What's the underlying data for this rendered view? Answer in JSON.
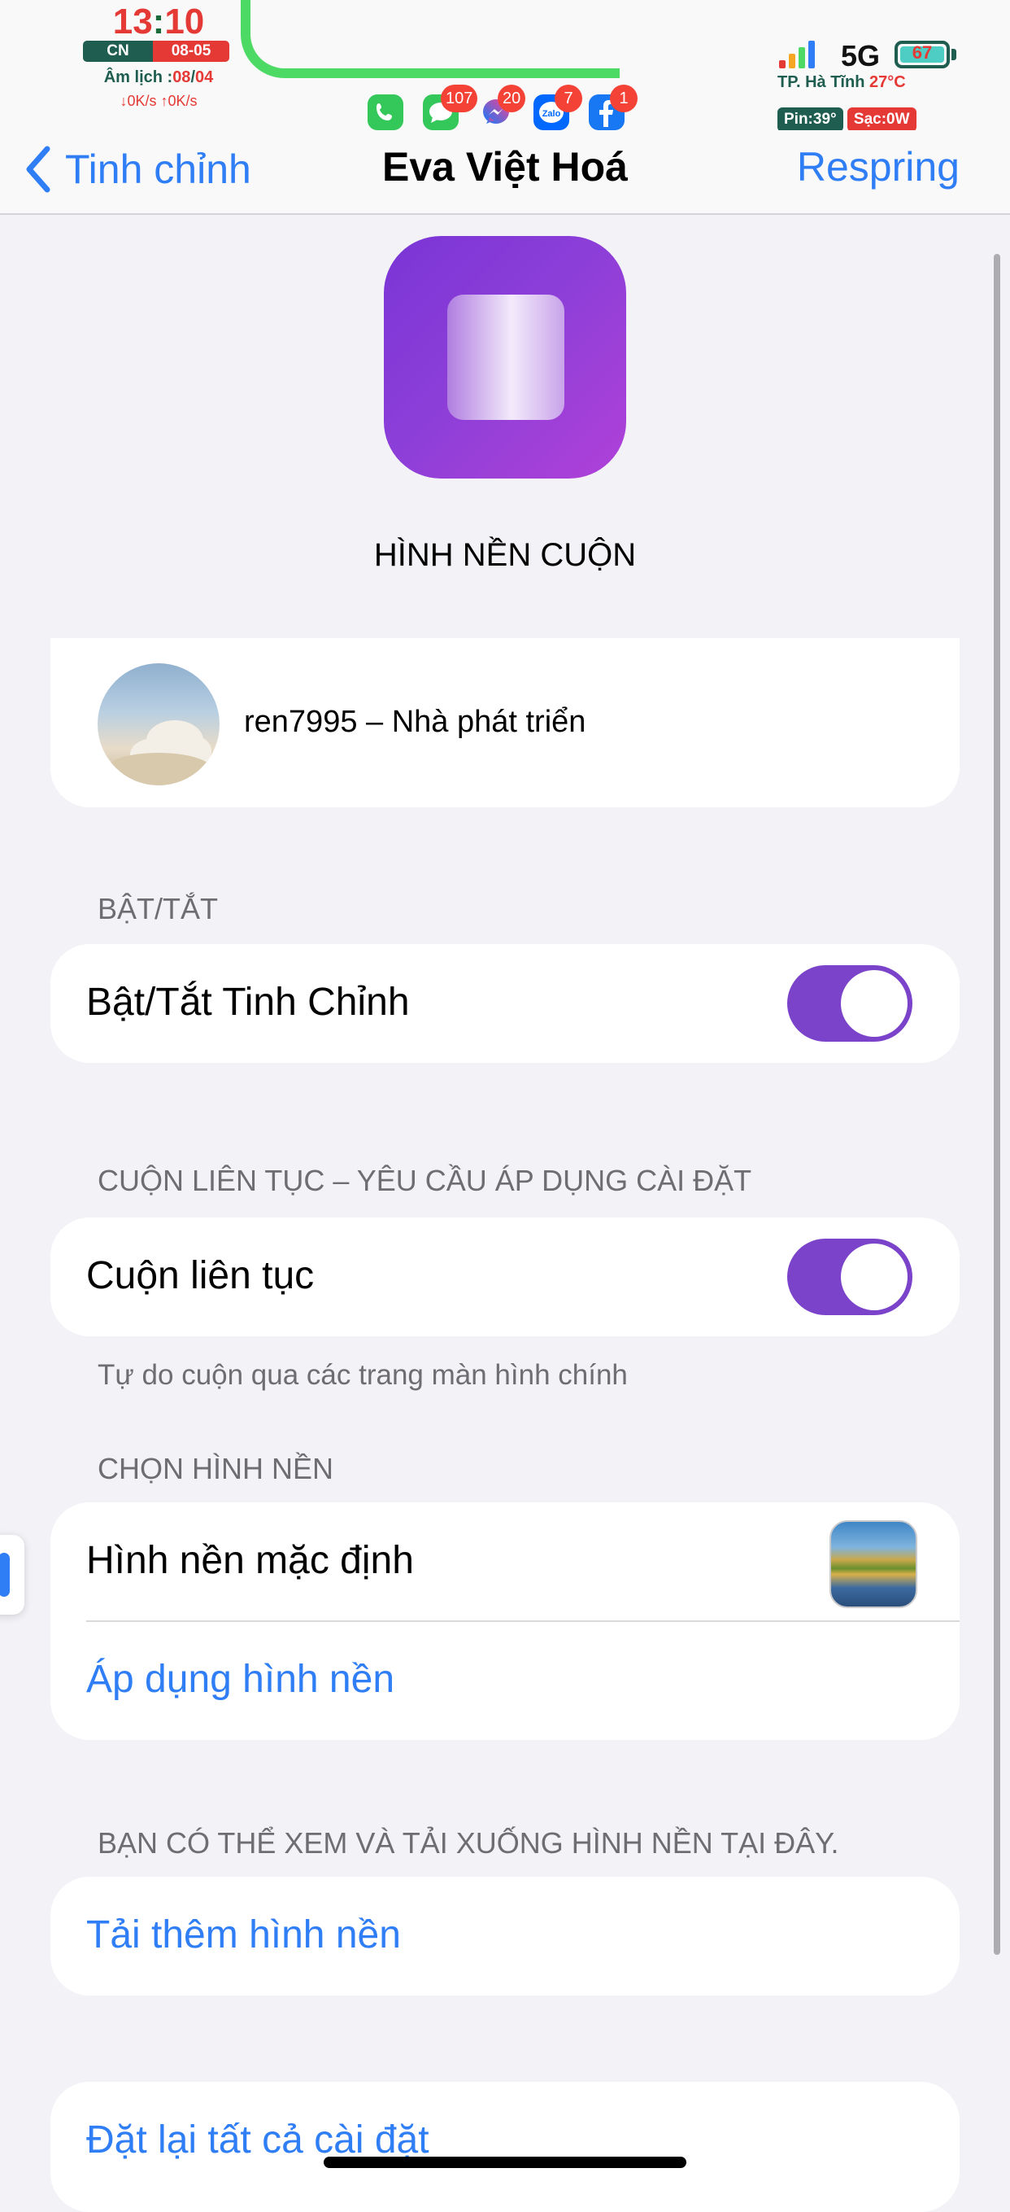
{
  "status_bar": {
    "time_hour": "13",
    "time_sep": ":",
    "time_min": "10",
    "weekday": "CN",
    "date": "08-05",
    "lunar_prefix": "Âm lịch :",
    "lunar_day": "08",
    "lunar_sep": "/",
    "lunar_month": "04",
    "net_speed": "↓0K/s ↑0K/s",
    "notifications": [
      {
        "app": "phone-icon",
        "color": "#34c759",
        "badge": ""
      },
      {
        "app": "messages-icon",
        "color": "#34c759",
        "badge": "107"
      },
      {
        "app": "messenger-icon",
        "color": "#7a5cff",
        "badge": "20"
      },
      {
        "app": "zalo-icon",
        "color": "#0068ff",
        "badge": "7"
      },
      {
        "app": "facebook-icon",
        "color": "#1877f2",
        "badge": "1"
      }
    ],
    "network": "5G",
    "battery": "67",
    "weather_city": "TP. Hà Tĩnh",
    "weather_temp": "27°C",
    "pin_temp": "Pin:39°",
    "charge": "Sạc:0W"
  },
  "nav": {
    "back_label": "Tinh chỉnh",
    "title": "Eva Việt Hoá",
    "right_action": "Respring"
  },
  "header": {
    "tweak_name": "HÌNH NỀN CUỘN"
  },
  "developer": {
    "label": "ren7995 – Nhà phát triển"
  },
  "section_enable": {
    "header": "BẬT/TẮT",
    "row_label": "Bật/Tắt Tinh Chỉnh",
    "enabled": true
  },
  "section_scroll": {
    "header": "CUỘN LIÊN TỤC – YÊU CẦU ÁP DỤNG CÀI ĐẶT",
    "row_label": "Cuộn liên tục",
    "enabled": true,
    "footer": "Tự do cuộn qua các trang màn hình chính"
  },
  "section_wallpaper": {
    "header": "CHỌN HÌNH NỀN",
    "row_label": "Hình nền mặc định",
    "apply_label": "Áp dụng hình nền"
  },
  "section_download": {
    "header": "BẠN CÓ THỂ XEM VÀ TẢI XUỐNG HÌNH NỀN TẠI ĐÂY.",
    "link_label": "Tải thêm hình nền"
  },
  "section_reset": {
    "link_label": "Đặt lại tất cả cài đặt"
  },
  "colors": {
    "accent": "#2f7ef5",
    "toggle_on": "#7b43c9",
    "icon_gradient_start": "#7a35d6",
    "icon_gradient_end": "#b041d8"
  }
}
